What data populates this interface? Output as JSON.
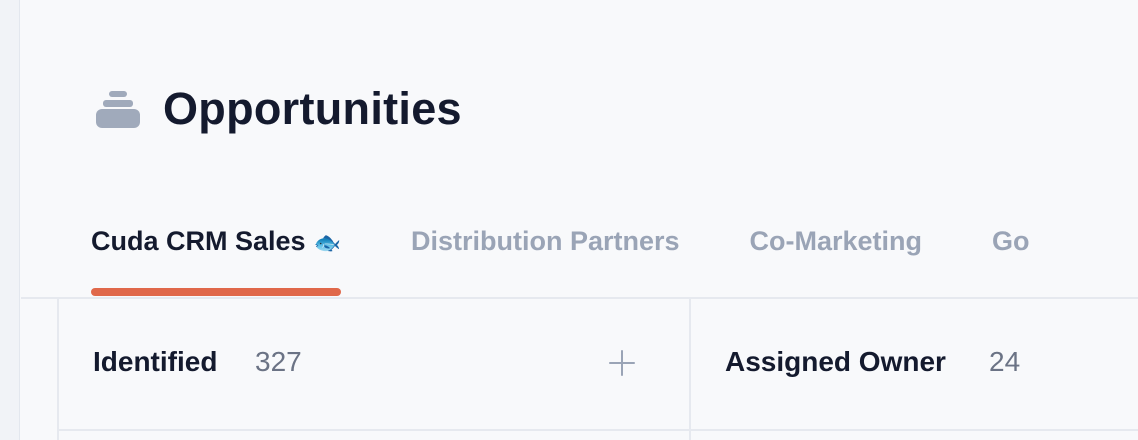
{
  "header": {
    "icon": "inbox-stack-icon",
    "title": "Opportunities"
  },
  "tabs": [
    {
      "label": "Cuda CRM Sales",
      "emoji": "🐟",
      "active": true
    },
    {
      "label": "Distribution Partners",
      "active": false
    },
    {
      "label": "Co-Marketing",
      "active": false
    },
    {
      "label": "Go",
      "active": false
    }
  ],
  "board": {
    "columns": [
      {
        "title": "Identified",
        "count": "327",
        "add_icon": "plus-icon"
      },
      {
        "title": "Assigned Owner",
        "count": "24"
      }
    ]
  },
  "colors": {
    "accent": "#e0684a",
    "text_primary": "#141a2e",
    "text_muted": "#9aa4b6",
    "background": "#f8f9fb"
  }
}
